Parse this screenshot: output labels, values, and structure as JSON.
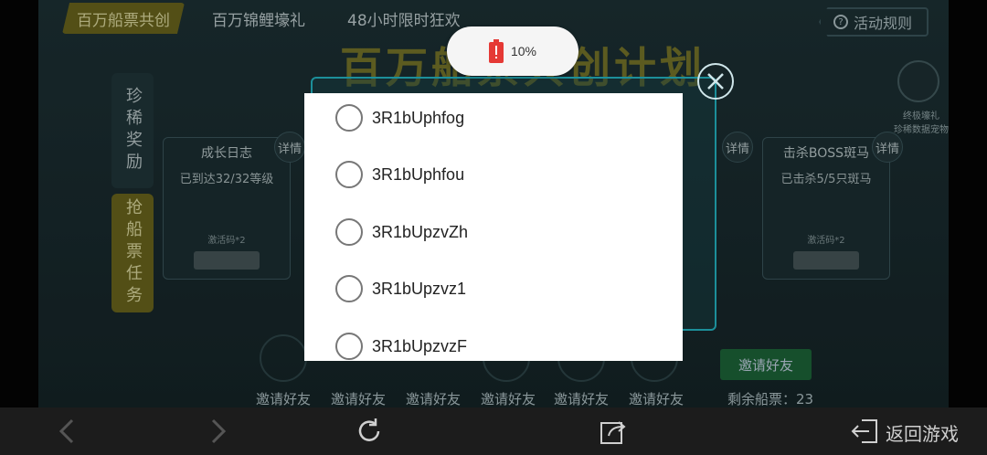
{
  "status": {
    "battery_text": "10%"
  },
  "tabs": [
    {
      "label": "百万船票共创"
    },
    {
      "label": "百万锦鲤壕礼"
    },
    {
      "label": "48小时限时狂欢"
    }
  ],
  "rules_label": "活动规则",
  "banner_title": "百万船票共创计划",
  "side_tabs": [
    {
      "label": "珍稀奖励"
    },
    {
      "label": "抢船票任务"
    }
  ],
  "cards": [
    {
      "title": "成长日志",
      "status": "已到达32/32等级",
      "reward": "激活码*2"
    },
    {
      "title": "击杀BOSS斑马",
      "status": "已击杀5/5只斑马",
      "reward": "激活码*2"
    }
  ],
  "detail_label": "详情",
  "top_right_reward": {
    "line1": "终极壕礼",
    "line2": "珍稀数据宠物"
  },
  "invite": {
    "slot_label": "邀请好友",
    "button_label": "邀请好友",
    "remaining_label": "剩余船票：23"
  },
  "bottom_nav": {
    "return_label": "返回游戏"
  },
  "dialog": {
    "options": [
      {
        "label": "3R1bUphfog"
      },
      {
        "label": "3R1bUphfou"
      },
      {
        "label": "3R1bUpzvZh"
      },
      {
        "label": "3R1bUpzvz1"
      },
      {
        "label": "3R1bUpzvzF"
      }
    ]
  },
  "colors": {
    "accent_gold": "#6f6a1e",
    "teal_frame": "#1c8f9a",
    "battery_red": "#e53935"
  }
}
